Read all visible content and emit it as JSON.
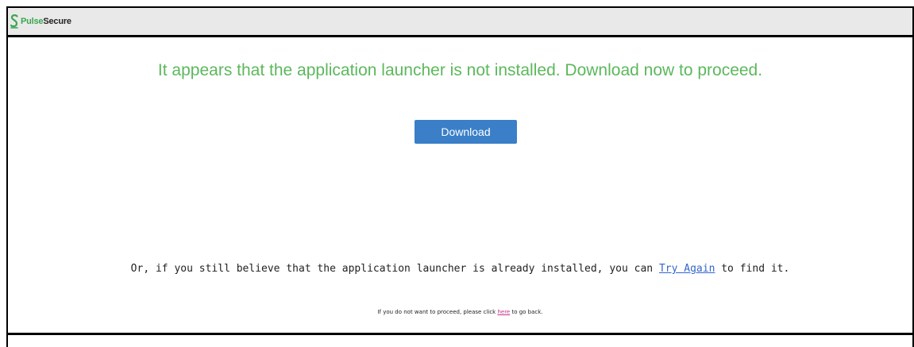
{
  "header": {
    "brand_first": "Pulse",
    "brand_second": "Secure",
    "logo_icon": "pulse-secure-s-icon",
    "brand_color": "#3aa651"
  },
  "main": {
    "headline": "It appears that the application launcher is not installed. Download now to proceed.",
    "headline_color": "#5cb85c",
    "download_label": "Download",
    "download_color": "#3a7fc8",
    "retry_prefix": "Or, if you still believe that the application launcher is already installed, you can ",
    "retry_link": "Try Again",
    "retry_suffix": " to find it.",
    "back_prefix": "If you do not want to proceed, please click ",
    "back_link": "here",
    "back_suffix": " to go back."
  }
}
